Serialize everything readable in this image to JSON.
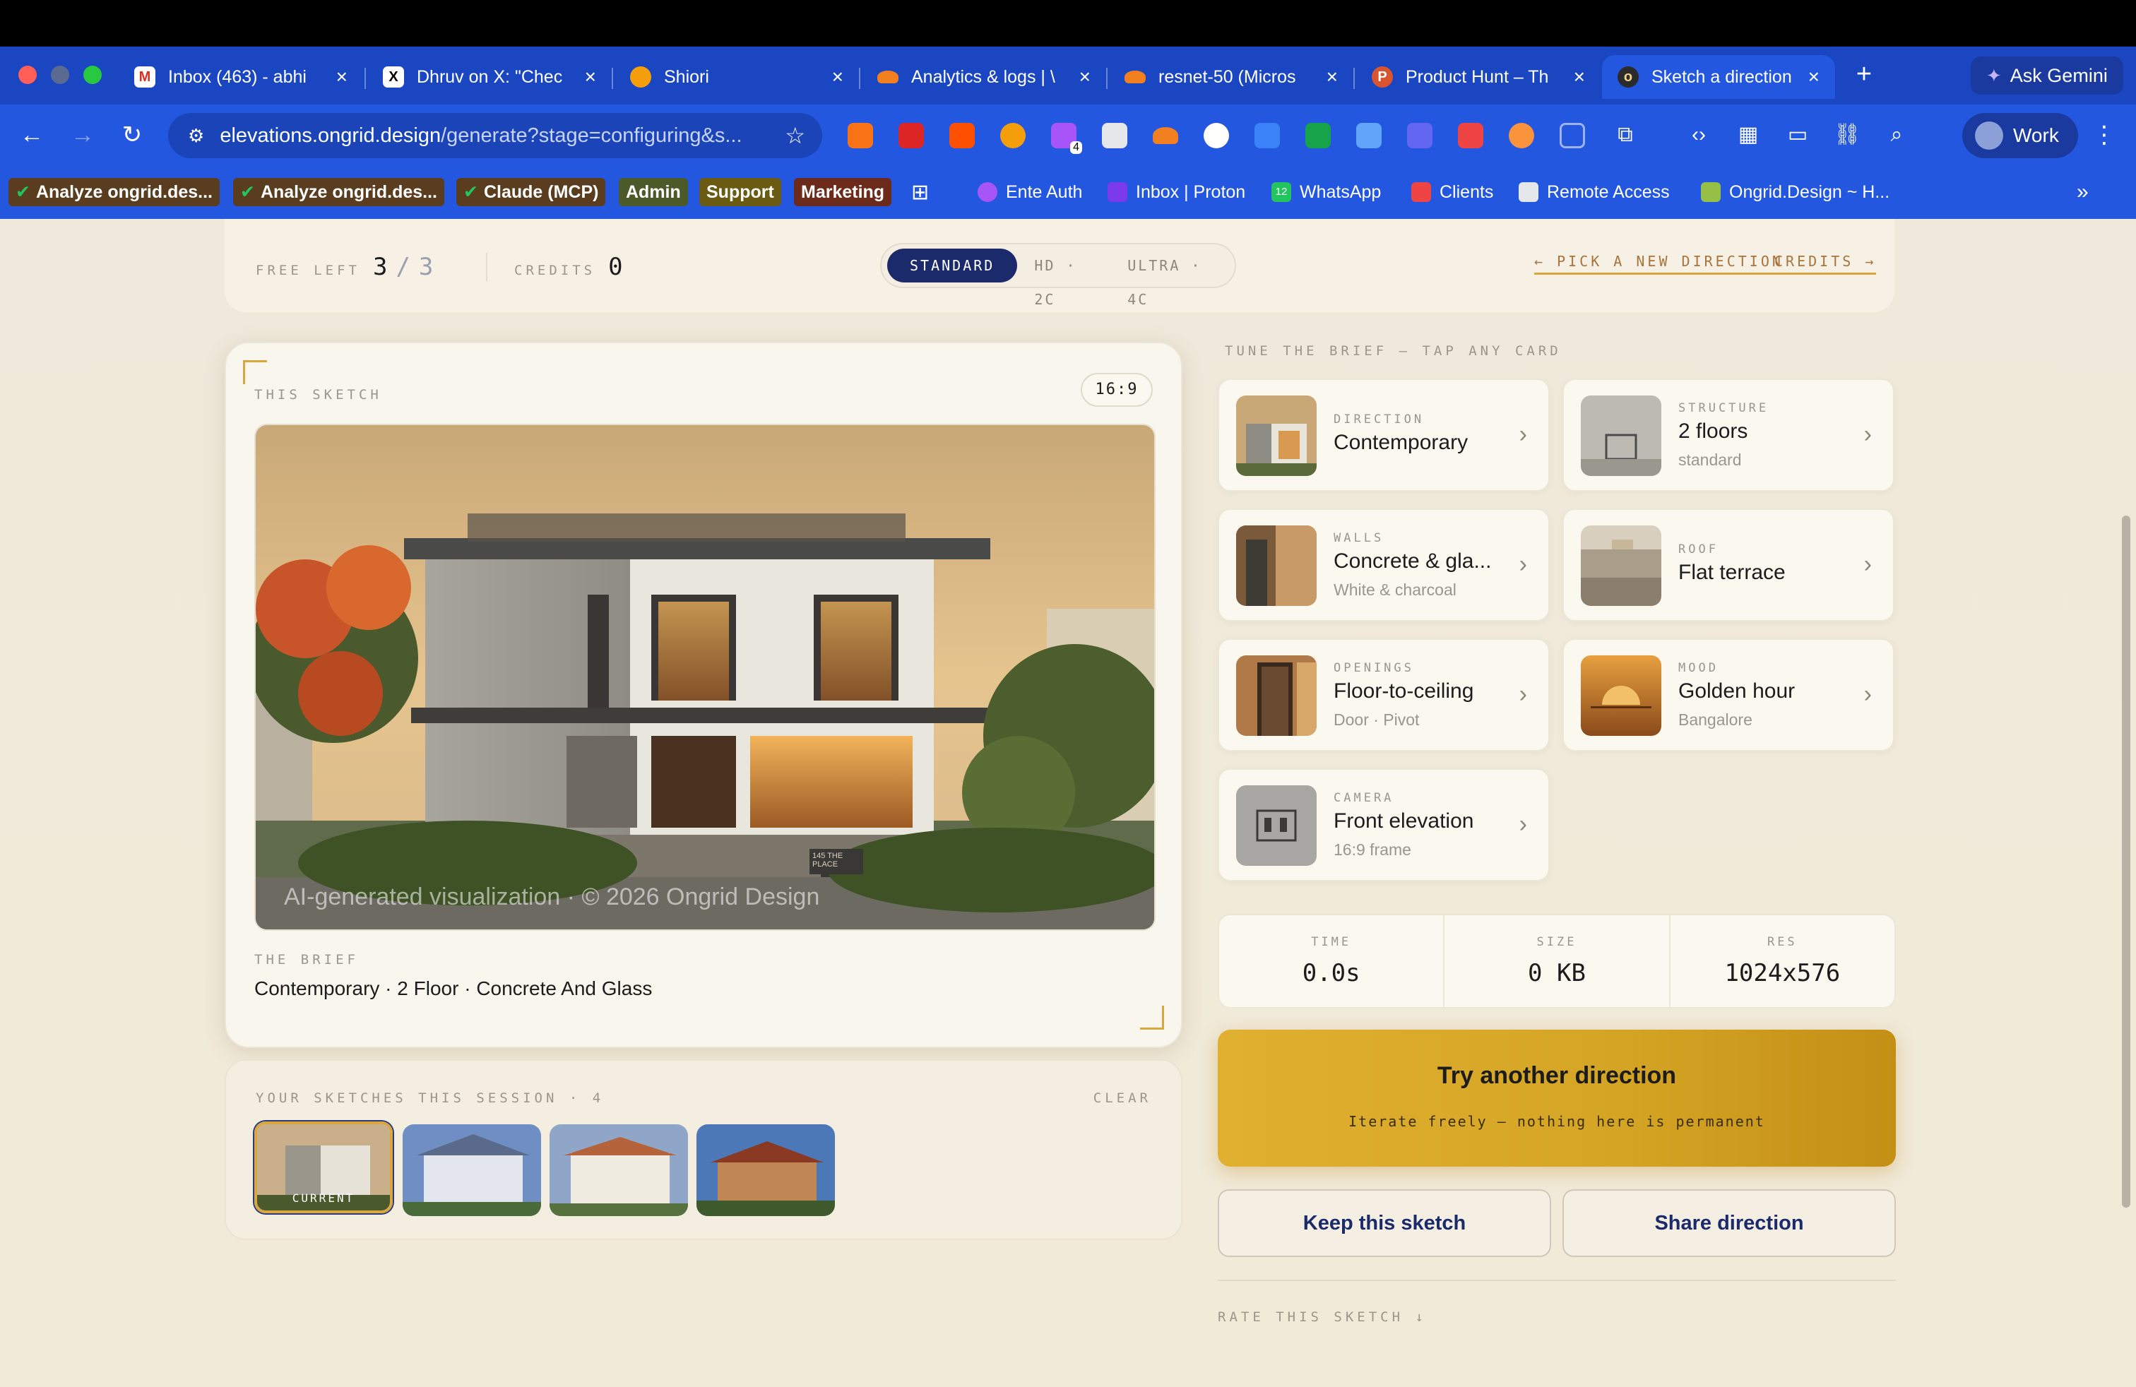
{
  "browser": {
    "tabs": [
      {
        "title": "Inbox (463) - abhi",
        "icon": "gmail-icon"
      },
      {
        "title": "Dhruv on X: \"Chec",
        "icon": "x-icon"
      },
      {
        "title": "Shiori",
        "icon": "shiori-icon"
      },
      {
        "title": "Analytics & logs | \\",
        "icon": "cloudflare-icon"
      },
      {
        "title": "resnet-50 (Micros",
        "icon": "cloudflare-icon"
      },
      {
        "title": "Product Hunt – Th",
        "icon": "producthunt-icon"
      },
      {
        "title": "Sketch a direction",
        "icon": "ongrid-icon"
      }
    ],
    "new_tab": "+",
    "ask_gemini": "Ask Gemini",
    "url_host": "elevations.ongrid.design",
    "url_path": "/generate?stage=configuring&s...",
    "extension_badge": "4",
    "profile": "Work",
    "bookmarks": [
      {
        "label": "Analyze ongrid.des...",
        "style": "check"
      },
      {
        "label": "Analyze ongrid.des...",
        "style": "check"
      },
      {
        "label": "Claude (MCP)",
        "style": "check"
      },
      {
        "label": "Admin",
        "style": "pill"
      },
      {
        "label": "Support",
        "style": "pill"
      },
      {
        "label": "Marketing",
        "style": "pill"
      },
      {
        "label": "Ente Auth",
        "style": "link"
      },
      {
        "label": "Inbox | Proton",
        "style": "link"
      },
      {
        "label": "WhatsApp",
        "style": "link",
        "badge": "12"
      },
      {
        "label": "Clients",
        "style": "link"
      },
      {
        "label": "Remote Access",
        "style": "link"
      },
      {
        "label": "Ongrid.Design ~ H...",
        "style": "link"
      }
    ],
    "bookmarks_overflow": "»"
  },
  "topbar": {
    "free_left_label": "FREE LEFT",
    "free_left_value": "3",
    "free_left_slash": "/",
    "free_left_total": "3",
    "credits_label": "CREDITS",
    "credits_value": "0",
    "quality_options": [
      "STANDARD",
      "HD · 2C",
      "ULTRA · 4C"
    ],
    "quality_selected": "STANDARD",
    "pick_new_direction": "← PICK A NEW DIRECTION",
    "credits_link": "CREDITS →"
  },
  "sketch": {
    "label": "THIS SKETCH",
    "ratio": "16:9",
    "watermark": "AI-generated visualization · © 2026 Ongrid Design",
    "plaque": "145 THE PLACE",
    "brief_label": "THE BRIEF",
    "brief": "Contemporary · 2 Floor · Concrete And Glass"
  },
  "session": {
    "label": "YOUR SKETCHES THIS SESSION · 4",
    "clear": "CLEAR",
    "current_label": "CURRENT",
    "count": 4
  },
  "tune": {
    "label": "TUNE THE BRIEF — TAP ANY CARD",
    "cards": [
      {
        "key": "DIRECTION",
        "value": "Contemporary",
        "sub": ""
      },
      {
        "key": "STRUCTURE",
        "value": "2 floors",
        "sub": "standard"
      },
      {
        "key": "WALLS",
        "value": "Concrete & gla...",
        "sub": "White & charcoal"
      },
      {
        "key": "ROOF",
        "value": "Flat terrace",
        "sub": ""
      },
      {
        "key": "OPENINGS",
        "value": "Floor-to-ceiling",
        "sub": "Door · Pivot"
      },
      {
        "key": "MOOD",
        "value": "Golden hour",
        "sub": "Bangalore"
      },
      {
        "key": "CAMERA",
        "value": "Front elevation",
        "sub": "16:9 frame"
      }
    ]
  },
  "stats": [
    {
      "key": "TIME",
      "value": "0.0s"
    },
    {
      "key": "SIZE",
      "value": "0 KB"
    },
    {
      "key": "RES",
      "value": "1024x576"
    }
  ],
  "actions": {
    "try_title": "Try another direction",
    "try_sub": "Iterate freely — nothing here is permanent",
    "keep": "Keep this sketch",
    "share": "Share direction",
    "rate": "RATE THIS SKETCH ↓"
  },
  "colors": {
    "accent_gold": "#d9a640",
    "navy": "#1b2a6a",
    "chrome_blue": "#2457e0"
  }
}
